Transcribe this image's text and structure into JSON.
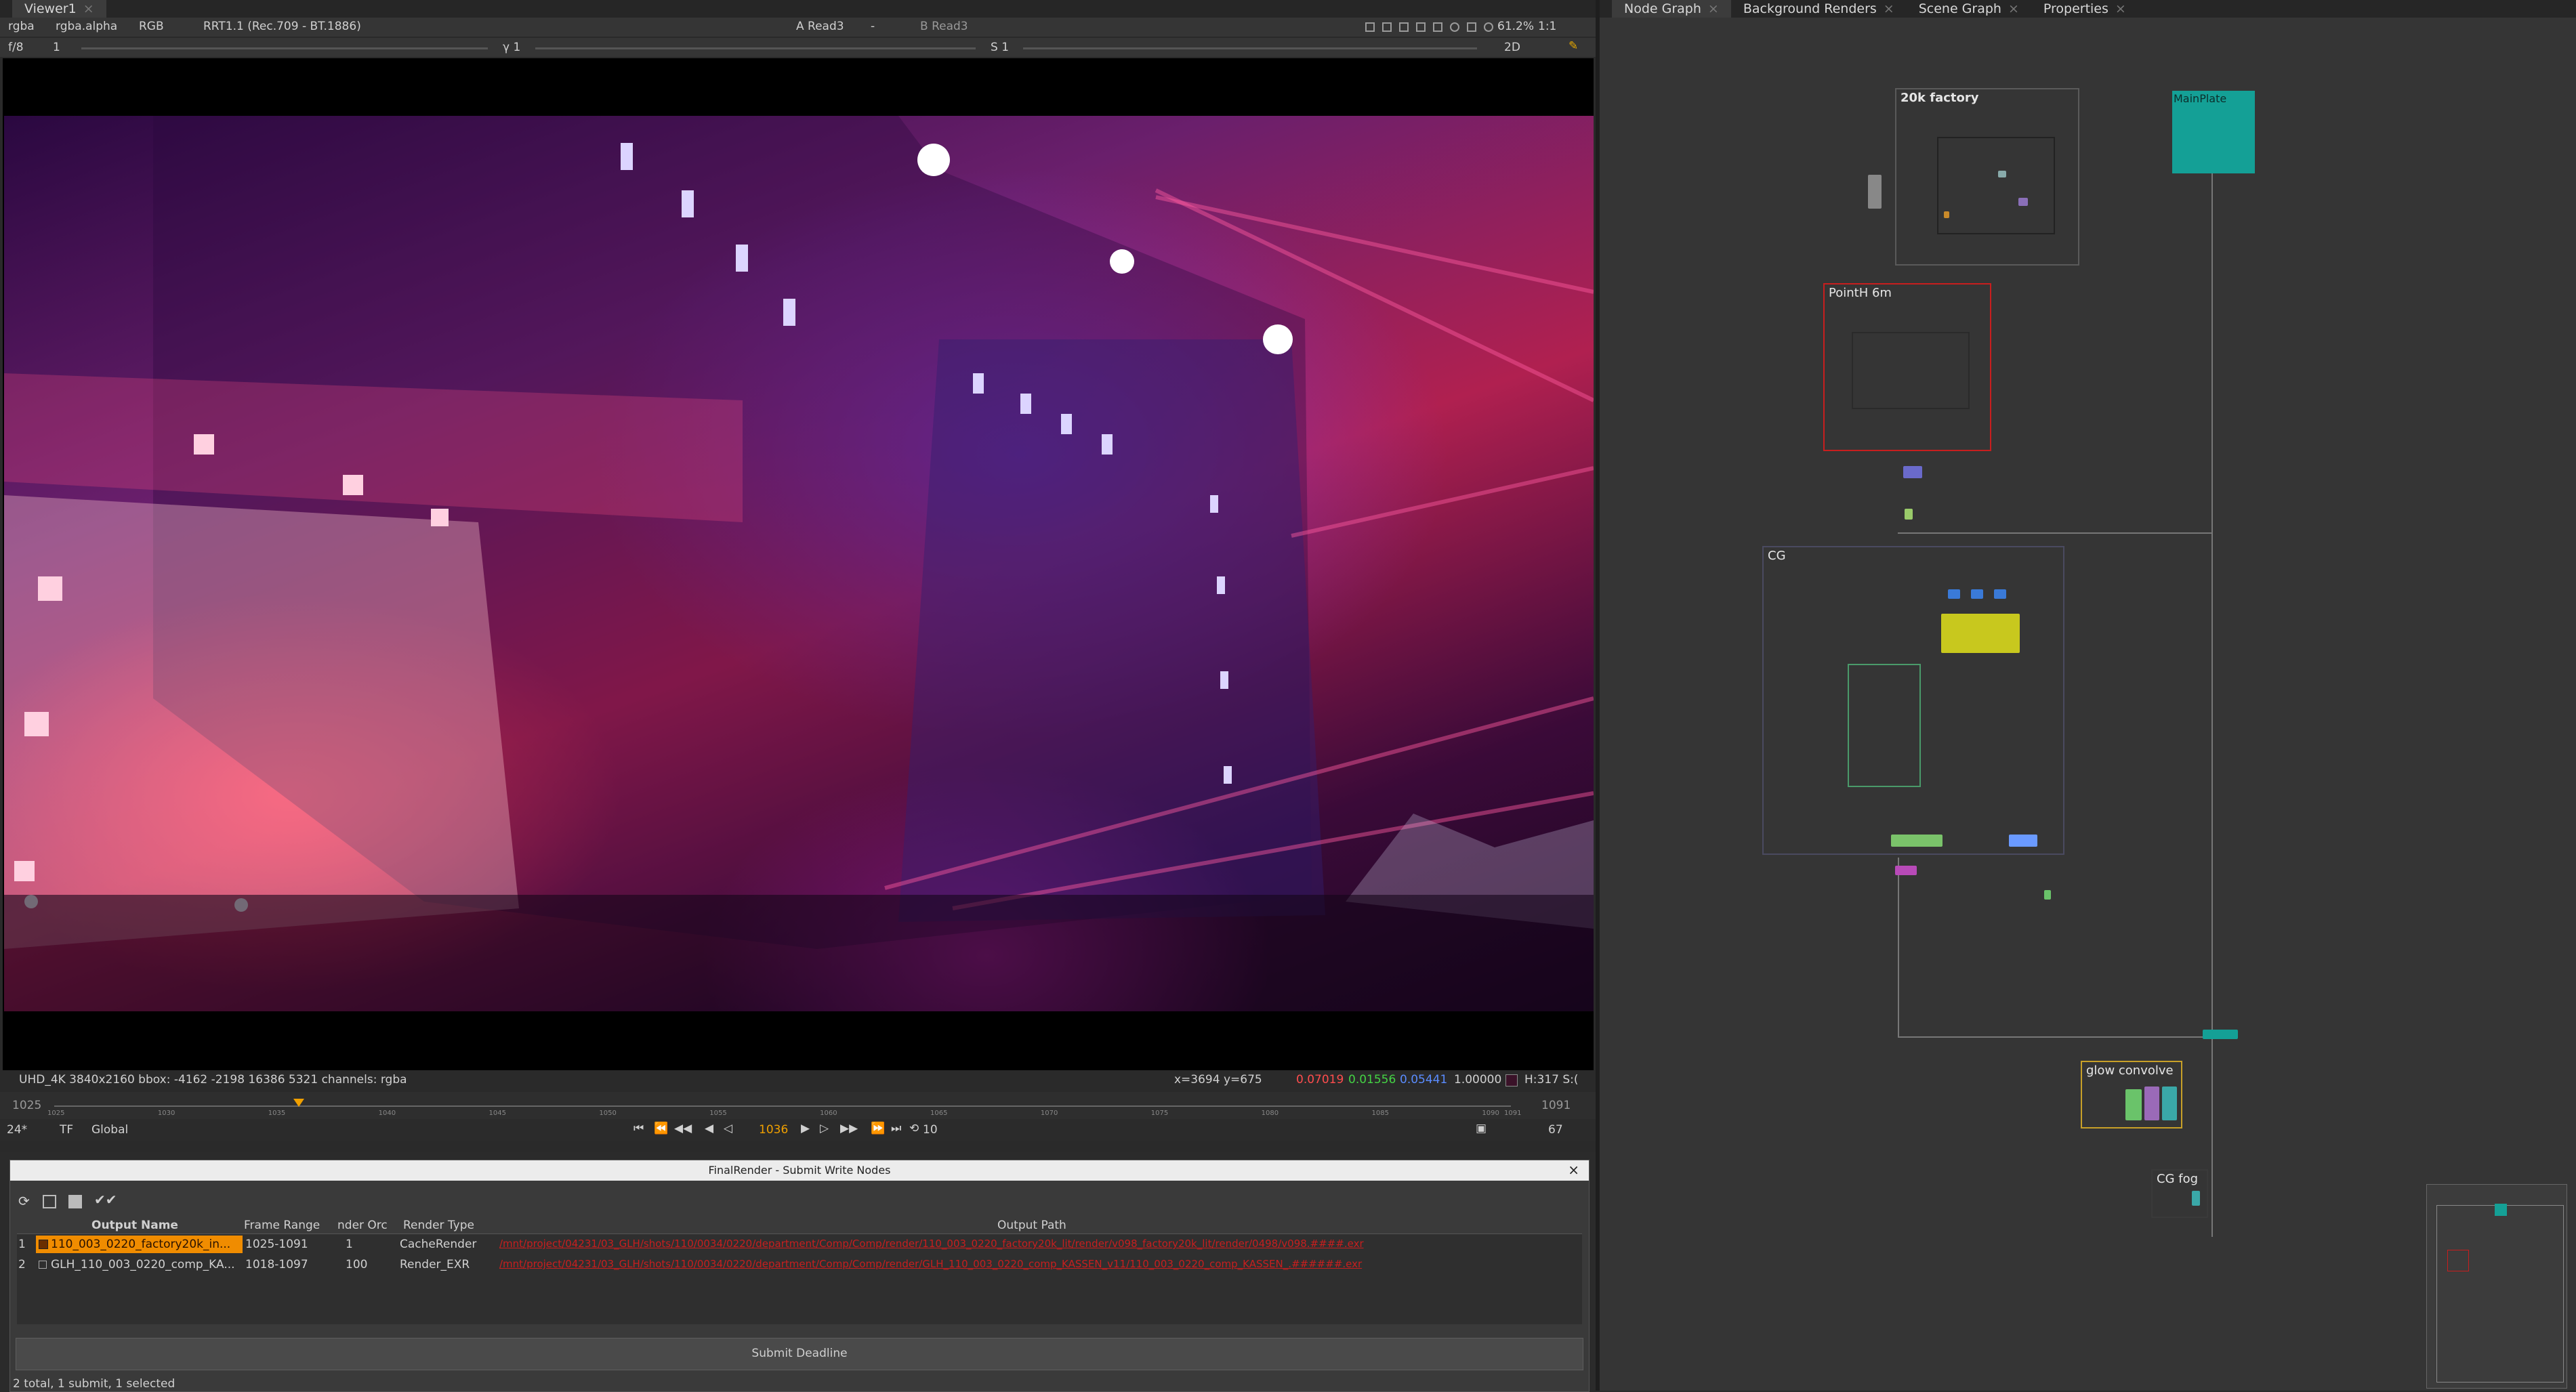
{
  "viewer": {
    "tab": "Viewer1",
    "toolbar1": {
      "channels": "rgba",
      "alpha": "rgba.alpha",
      "colorspace": "RGB",
      "view_transform": "RRT1.1 (Rec.709 - BT.1886)",
      "input_a": "A Read3",
      "input_a_op": "-",
      "input_b": "B Read3",
      "zoom": "61.2%",
      "proxy": "1:1"
    },
    "toolbar2": {
      "fstop": "f/8",
      "frame_step": "1",
      "gamma_label": "γ 1",
      "saturation_label": "S 1",
      "view_mode": "2D"
    },
    "info": {
      "format": "UHD_4K 3840x2160  bbox: -4162 -2198 16386 5321 channels: rgba",
      "coords": "x=3694 y=675",
      "r": "0.07019",
      "g": "0.01556",
      "b": "0.05441",
      "a": "1.00000",
      "hsv": "H:317 S:("
    },
    "timeline": {
      "start": "1025",
      "end": "1091",
      "fps": "24*",
      "tf": "TF",
      "scope": "Global",
      "current_frame": "1036",
      "increment": "10",
      "frame_count": "67",
      "ticks": [
        "1025",
        "1030",
        "1035",
        "1040",
        "1045",
        "1050",
        "1055",
        "1060",
        "1065",
        "1070",
        "1075",
        "1080",
        "1085",
        "1090",
        "1091"
      ]
    }
  },
  "dialog": {
    "title": "FinalRender - Submit Write Nodes",
    "columns": [
      "Output Name",
      "Frame Range",
      "nder Orc",
      "Render Type",
      "Output Path"
    ],
    "rows": [
      {
        "num": "1",
        "name": "110_003_0220_factory20k_in...",
        "range": "1025-1091",
        "order": "1",
        "type": "CacheRender",
        "path": "/mnt/project/04231/03_GLH/shots/110/0034/0220/department/Comp/Comp/render/110_003_0220_factory20k_lit/render/v098_factory20k_lit/render/0498/v098.####.exr"
      },
      {
        "num": "2",
        "name": "GLH_110_003_0220_comp_KA...",
        "range": "1018-1097",
        "order": "100",
        "type": "Render_EXR",
        "path": "/mnt/project/04231/03_GLH/shots/110/0034/0220/department/Comp/Comp/render/GLH_110_003_0220_comp_KASSEN_v11/110_003_0220_comp_KASSEN_.######.exr"
      }
    ],
    "submit_label": "Submit Deadline",
    "status": "2 total, 1 submit, 1 selected"
  },
  "nodegraph": {
    "tabs": [
      "Node Graph",
      "Background Renders",
      "Scene Graph",
      "Properties"
    ],
    "backdrops": {
      "factory": "20k factory",
      "pointh": "PointH 6m",
      "cg": "CG",
      "glow": "glow convolve",
      "cgfog": "CG fog",
      "mainplate": "MainPlate"
    }
  },
  "colors": {
    "accent_orange": "#f08c00",
    "error_red": "#c81e1e",
    "teal": "#14a096",
    "yellow_node": "#c8c81e"
  }
}
